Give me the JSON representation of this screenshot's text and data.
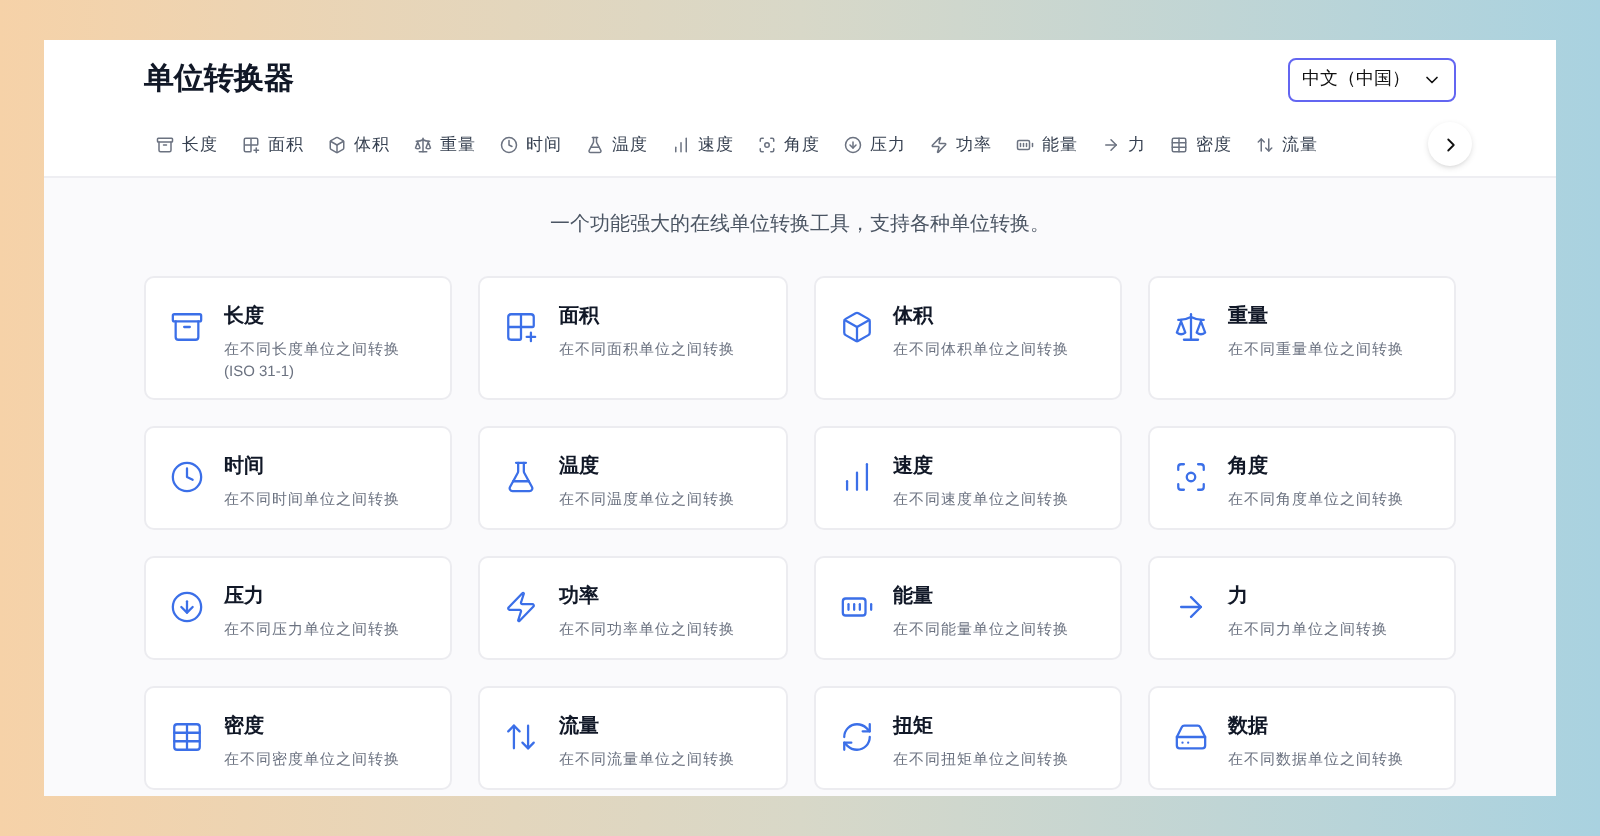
{
  "header": {
    "title": "单位转换器",
    "language_select": {
      "value": "中文（中国）"
    }
  },
  "tabs": [
    {
      "label": "长度"
    },
    {
      "label": "面积"
    },
    {
      "label": "体积"
    },
    {
      "label": "重量"
    },
    {
      "label": "时间"
    },
    {
      "label": "温度"
    },
    {
      "label": "速度"
    },
    {
      "label": "角度"
    },
    {
      "label": "压力"
    },
    {
      "label": "功率"
    },
    {
      "label": "能量"
    },
    {
      "label": "力"
    },
    {
      "label": "密度"
    },
    {
      "label": "流量"
    }
  ],
  "tagline": "一个功能强大的在线单位转换工具，支持各种单位转换。",
  "cards": [
    {
      "title": "长度",
      "description": "在不同长度单位之间转换 (ISO 31-1)"
    },
    {
      "title": "面积",
      "description": "在不同面积单位之间转换"
    },
    {
      "title": "体积",
      "description": "在不同体积单位之间转换"
    },
    {
      "title": "重量",
      "description": "在不同重量单位之间转换"
    },
    {
      "title": "时间",
      "description": "在不同时间单位之间转换"
    },
    {
      "title": "温度",
      "description": "在不同温度单位之间转换"
    },
    {
      "title": "速度",
      "description": "在不同速度单位之间转换"
    },
    {
      "title": "角度",
      "description": "在不同角度单位之间转换"
    },
    {
      "title": "压力",
      "description": "在不同压力单位之间转换"
    },
    {
      "title": "功率",
      "description": "在不同功率单位之间转换"
    },
    {
      "title": "能量",
      "description": "在不同能量单位之间转换"
    },
    {
      "title": "力",
      "description": "在不同力单位之间转换"
    },
    {
      "title": "密度",
      "description": "在不同密度单位之间转换"
    },
    {
      "title": "流量",
      "description": "在不同流量单位之间转换"
    },
    {
      "title": "扭矩",
      "description": "在不同扭矩单位之间转换"
    },
    {
      "title": "数据",
      "description": "在不同数据单位之间转换"
    }
  ]
}
